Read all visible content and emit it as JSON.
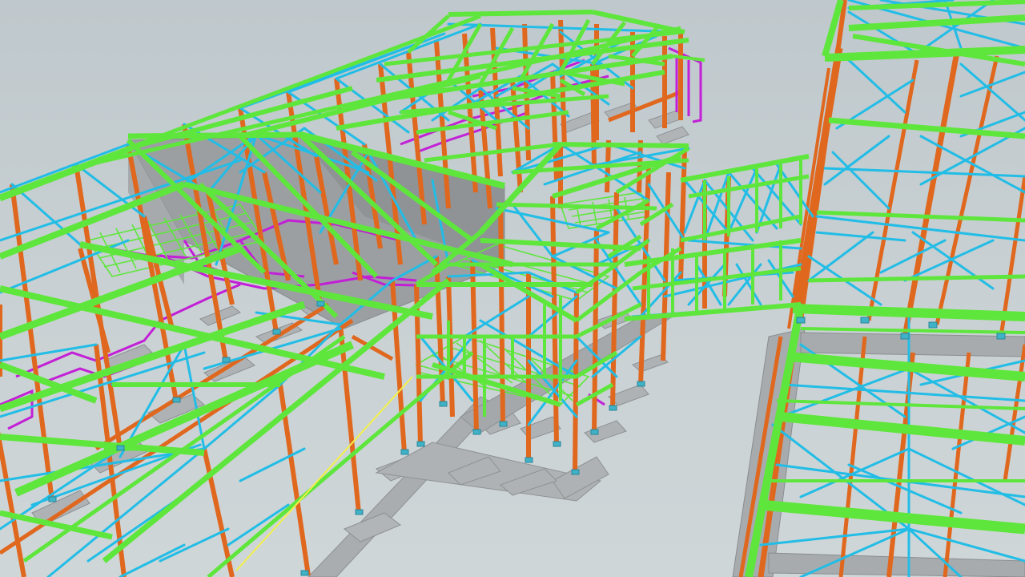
{
  "viewport": {
    "background": "#c6cfd2"
  },
  "palette": {
    "column": "#e0671e",
    "beam": "#5fe63c",
    "brace": "#22bde6",
    "pipe": "#c21fd6",
    "rail": "#f2f04a",
    "concrete": "#a9adaf",
    "wall": "#9ea3a6",
    "plate": "#3fb2c8"
  },
  "structures": [
    {
      "name": "left-steel-hall"
    },
    {
      "name": "center-mezzanine-tower"
    },
    {
      "name": "bridge-truss"
    },
    {
      "name": "right-steel-hall"
    }
  ]
}
